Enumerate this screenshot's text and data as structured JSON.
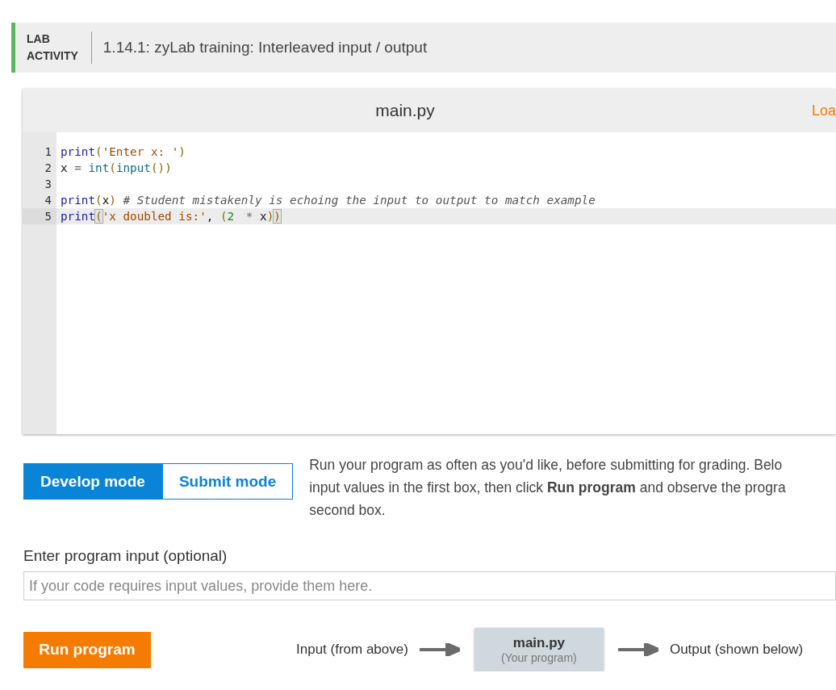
{
  "header": {
    "label_lines": [
      "LAB",
      "ACTIVITY"
    ],
    "title": "1.14.1: zyLab training: Interleaved input / output"
  },
  "editor": {
    "filename": "main.py",
    "action": "Loa",
    "lines": [
      {
        "number": "1",
        "active": false,
        "tokens": [
          {
            "kind": "keyword",
            "text": "print"
          },
          {
            "kind": "bracket",
            "text": "("
          },
          {
            "kind": "string",
            "text": "'Enter x: '"
          },
          {
            "kind": "bracket",
            "text": ")"
          }
        ]
      },
      {
        "number": "2",
        "active": false,
        "tokens": [
          {
            "kind": "plain",
            "text": "x"
          },
          {
            "kind": "operator",
            "text": " = "
          },
          {
            "kind": "builtin",
            "text": "int"
          },
          {
            "kind": "bracket",
            "text": "("
          },
          {
            "kind": "builtin",
            "text": "input"
          },
          {
            "kind": "bracket",
            "text": "())"
          }
        ]
      },
      {
        "number": "3",
        "active": false
      },
      {
        "number": "4",
        "active": false,
        "tokens": [
          {
            "kind": "keyword",
            "text": "print"
          },
          {
            "kind": "bracket",
            "text": "("
          },
          {
            "kind": "plain",
            "text": "x"
          },
          {
            "kind": "bracket",
            "text": ") "
          },
          {
            "kind": "comment",
            "text": "# Student mistakenly is echoing the input to output to match example"
          }
        ]
      },
      {
        "number": "5",
        "active": true,
        "tokens": [
          {
            "kind": "keyword",
            "text": "print"
          },
          {
            "kind": "matched",
            "text": "("
          },
          {
            "kind": "string",
            "text": "'x doubled is:'"
          },
          {
            "kind": "plain",
            "text": ", "
          },
          {
            "kind": "bracket",
            "text": "("
          },
          {
            "kind": "number",
            "text": "2"
          },
          {
            "kind": "operator",
            "text": " * "
          },
          {
            "kind": "plain",
            "text": "x"
          },
          {
            "kind": "bracket",
            "text": ")"
          },
          {
            "kind": "matched",
            "text": ")"
          }
        ]
      }
    ]
  },
  "modes": [
    {
      "label": "Develop mode",
      "selected": true
    },
    {
      "label": "Submit mode",
      "selected": false
    }
  ],
  "instructions": [
    "Run your program as often as you'd like, before submitting for grading. Belo",
    "input values in the first box, then click **Run program** and observe the progra",
    "second box."
  ],
  "input": {
    "label": "Enter program input (optional)",
    "placeholder": "If your code requires input values, provide them here."
  },
  "run_button": "Run program",
  "flow": {
    "input_label": "Input (from above)",
    "program_name": "main.py",
    "program_caption": "(Your program)",
    "output_label": "Output (shown below)"
  }
}
